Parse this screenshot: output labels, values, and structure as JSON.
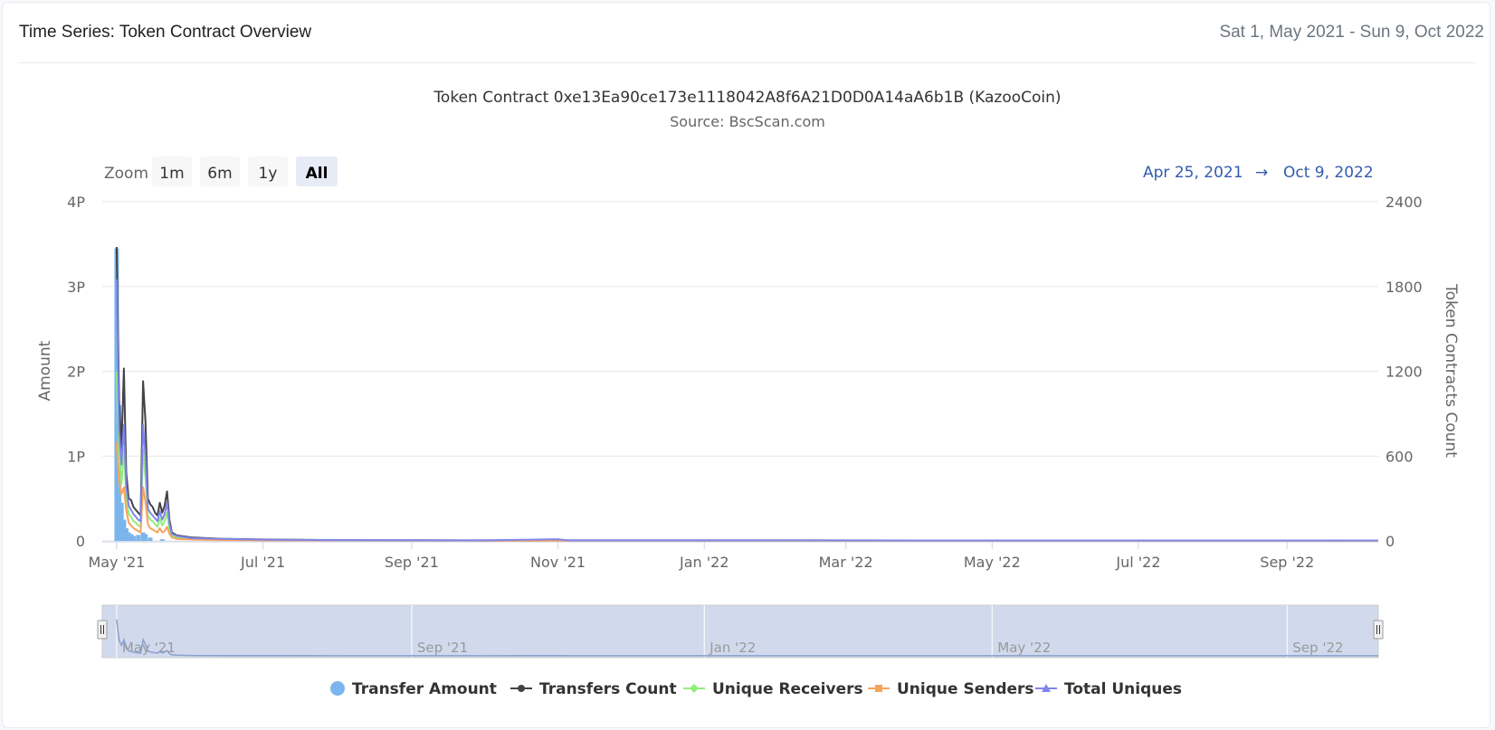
{
  "header": {
    "title": "Time Series: Token Contract Overview",
    "date_range": "Sat 1, May 2021 - Sun 9, Oct 2022"
  },
  "chart": {
    "title": "Token Contract 0xe13Ea90ce173e1118042A8f6A21D0D0A14aA6b1B (KazooCoin)",
    "subtitle": "Source: BscScan.com",
    "zoom_label": "Zoom",
    "zoom_buttons": [
      "1m",
      "6m",
      "1y",
      "All"
    ],
    "zoom_selected": "All",
    "range_from": "Apr 25, 2021",
    "range_arrow": "→",
    "range_to": "Oct 9, 2022"
  },
  "chart_data": {
    "type": "line",
    "x_type": "date",
    "x_range": [
      "2021-04-25",
      "2022-10-09"
    ],
    "xticks": [
      {
        "date": "2021-05-01",
        "label": "May '21"
      },
      {
        "date": "2021-07-01",
        "label": "Jul '21"
      },
      {
        "date": "2021-09-01",
        "label": "Sep '21"
      },
      {
        "date": "2021-11-01",
        "label": "Nov '21"
      },
      {
        "date": "2022-01-01",
        "label": "Jan '22"
      },
      {
        "date": "2022-03-01",
        "label": "Mar '22"
      },
      {
        "date": "2022-05-01",
        "label": "May '22"
      },
      {
        "date": "2022-07-01",
        "label": "Jul '22"
      },
      {
        "date": "2022-09-01",
        "label": "Sep '22"
      }
    ],
    "navigator_ticks": [
      {
        "date": "2021-05-01",
        "label": "May '21"
      },
      {
        "date": "2021-09-01",
        "label": "Sep '21"
      },
      {
        "date": "2022-01-01",
        "label": "Jan '22"
      },
      {
        "date": "2022-05-01",
        "label": "May '22"
      },
      {
        "date": "2022-09-01",
        "label": "Sep '22"
      }
    ],
    "y_left": {
      "label": "Amount",
      "range": [
        0,
        4
      ],
      "ticks": [
        {
          "v": 0,
          "label": "0"
        },
        {
          "v": 1,
          "label": "1P"
        },
        {
          "v": 2,
          "label": "2P"
        },
        {
          "v": 3,
          "label": "3P"
        },
        {
          "v": 4,
          "label": "4P"
        }
      ]
    },
    "y_right": {
      "label": "Token Contracts Count",
      "range": [
        0,
        2400
      ],
      "ticks": [
        {
          "v": 0,
          "label": "0"
        },
        {
          "v": 600,
          "label": "600"
        },
        {
          "v": 1200,
          "label": "1200"
        },
        {
          "v": 1800,
          "label": "1800"
        },
        {
          "v": 2400,
          "label": "2400"
        }
      ]
    },
    "grid": true,
    "legend_position": "bottom",
    "series": [
      {
        "name": "Transfer Amount",
        "kind": "column",
        "axis": "left",
        "color": "#7cb5ec",
        "marker": "circle",
        "points": [
          [
            "2021-05-01",
            3.45
          ],
          [
            "2021-05-02",
            1.6
          ],
          [
            "2021-05-03",
            0.45
          ],
          [
            "2021-05-04",
            0.25
          ],
          [
            "2021-05-05",
            0.15
          ],
          [
            "2021-05-06",
            0.1
          ],
          [
            "2021-05-07",
            0.08
          ],
          [
            "2021-05-08",
            0.06
          ],
          [
            "2021-05-10",
            0.07
          ],
          [
            "2021-05-12",
            0.1
          ],
          [
            "2021-05-13",
            0.08
          ],
          [
            "2021-05-15",
            0.04
          ],
          [
            "2021-05-20",
            0.02
          ]
        ]
      },
      {
        "name": "Transfers Count",
        "kind": "line",
        "axis": "right",
        "color": "#434348",
        "marker": "circle",
        "points": [
          [
            "2021-05-01",
            2080
          ],
          [
            "2021-05-02",
            1000
          ],
          [
            "2021-05-03",
            650
          ],
          [
            "2021-05-04",
            1220
          ],
          [
            "2021-05-05",
            480
          ],
          [
            "2021-05-06",
            300
          ],
          [
            "2021-05-07",
            290
          ],
          [
            "2021-05-08",
            240
          ],
          [
            "2021-05-09",
            220
          ],
          [
            "2021-05-10",
            200
          ],
          [
            "2021-05-11",
            180
          ],
          [
            "2021-05-12",
            1130
          ],
          [
            "2021-05-13",
            850
          ],
          [
            "2021-05-14",
            300
          ],
          [
            "2021-05-15",
            260
          ],
          [
            "2021-05-16",
            240
          ],
          [
            "2021-05-17",
            200
          ],
          [
            "2021-05-18",
            180
          ],
          [
            "2021-05-19",
            270
          ],
          [
            "2021-05-20",
            200
          ],
          [
            "2021-05-21",
            250
          ],
          [
            "2021-05-22",
            350
          ],
          [
            "2021-05-23",
            150
          ],
          [
            "2021-05-24",
            60
          ],
          [
            "2021-05-26",
            40
          ],
          [
            "2021-06-01",
            25
          ],
          [
            "2021-06-15",
            15
          ],
          [
            "2021-07-01",
            10
          ],
          [
            "2021-08-01",
            6
          ],
          [
            "2021-10-01",
            4
          ],
          [
            "2022-10-09",
            3
          ]
        ]
      },
      {
        "name": "Unique Receivers",
        "kind": "line",
        "axis": "right",
        "color": "#90ed7d",
        "marker": "diamond",
        "points": [
          [
            "2021-05-01",
            1200
          ],
          [
            "2021-05-02",
            600
          ],
          [
            "2021-05-03",
            400
          ],
          [
            "2021-05-04",
            650
          ],
          [
            "2021-05-05",
            300
          ],
          [
            "2021-05-06",
            190
          ],
          [
            "2021-05-07",
            170
          ],
          [
            "2021-05-08",
            140
          ],
          [
            "2021-05-09",
            130
          ],
          [
            "2021-05-10",
            110
          ],
          [
            "2021-05-11",
            100
          ],
          [
            "2021-05-12",
            650
          ],
          [
            "2021-05-13",
            450
          ],
          [
            "2021-05-14",
            180
          ],
          [
            "2021-05-15",
            150
          ],
          [
            "2021-05-16",
            140
          ],
          [
            "2021-05-17",
            120
          ],
          [
            "2021-05-18",
            100
          ],
          [
            "2021-05-19",
            160
          ],
          [
            "2021-05-20",
            110
          ],
          [
            "2021-05-21",
            140
          ],
          [
            "2021-05-22",
            200
          ],
          [
            "2021-05-23",
            90
          ],
          [
            "2021-05-24",
            35
          ],
          [
            "2021-05-26",
            25
          ],
          [
            "2021-06-01",
            15
          ],
          [
            "2021-06-15",
            10
          ],
          [
            "2021-07-01",
            6
          ],
          [
            "2021-08-01",
            4
          ],
          [
            "2021-10-01",
            3
          ],
          [
            "2022-10-09",
            2
          ]
        ]
      },
      {
        "name": "Unique Senders",
        "kind": "line",
        "axis": "right",
        "color": "#f7a35c",
        "marker": "square",
        "points": [
          [
            "2021-05-01",
            700
          ],
          [
            "2021-05-02",
            420
          ],
          [
            "2021-05-03",
            330
          ],
          [
            "2021-05-04",
            380
          ],
          [
            "2021-05-05",
            220
          ],
          [
            "2021-05-06",
            130
          ],
          [
            "2021-05-07",
            110
          ],
          [
            "2021-05-08",
            90
          ],
          [
            "2021-05-09",
            80
          ],
          [
            "2021-05-10",
            70
          ],
          [
            "2021-05-11",
            60
          ],
          [
            "2021-05-12",
            380
          ],
          [
            "2021-05-13",
            280
          ],
          [
            "2021-05-14",
            120
          ],
          [
            "2021-05-15",
            90
          ],
          [
            "2021-05-16",
            80
          ],
          [
            "2021-05-17",
            70
          ],
          [
            "2021-05-18",
            60
          ],
          [
            "2021-05-19",
            90
          ],
          [
            "2021-05-20",
            60
          ],
          [
            "2021-05-21",
            70
          ],
          [
            "2021-05-22",
            100
          ],
          [
            "2021-05-23",
            50
          ],
          [
            "2021-05-24",
            25
          ],
          [
            "2021-05-26",
            15
          ],
          [
            "2021-06-01",
            10
          ],
          [
            "2021-06-15",
            6
          ],
          [
            "2021-07-01",
            4
          ],
          [
            "2021-08-01",
            3
          ],
          [
            "2021-10-01",
            2
          ],
          [
            "2022-10-09",
            2
          ]
        ]
      },
      {
        "name": "Total Uniques",
        "kind": "line",
        "axis": "right",
        "color": "#8085e9",
        "marker": "triangle",
        "points": [
          [
            "2021-05-01",
            1850
          ],
          [
            "2021-05-02",
            780
          ],
          [
            "2021-05-03",
            540
          ],
          [
            "2021-05-04",
            820
          ],
          [
            "2021-05-05",
            380
          ],
          [
            "2021-05-06",
            250
          ],
          [
            "2021-05-07",
            220
          ],
          [
            "2021-05-08",
            190
          ],
          [
            "2021-05-09",
            170
          ],
          [
            "2021-05-10",
            150
          ],
          [
            "2021-05-11",
            140
          ],
          [
            "2021-05-12",
            820
          ],
          [
            "2021-05-13",
            600
          ],
          [
            "2021-05-14",
            230
          ],
          [
            "2021-05-15",
            200
          ],
          [
            "2021-05-16",
            180
          ],
          [
            "2021-05-17",
            160
          ],
          [
            "2021-05-18",
            140
          ],
          [
            "2021-05-19",
            210
          ],
          [
            "2021-05-20",
            150
          ],
          [
            "2021-05-21",
            190
          ],
          [
            "2021-05-22",
            270
          ],
          [
            "2021-05-23",
            120
          ],
          [
            "2021-05-24",
            50
          ],
          [
            "2021-05-26",
            35
          ],
          [
            "2021-06-01",
            20
          ],
          [
            "2021-06-15",
            14
          ],
          [
            "2021-07-01",
            9
          ],
          [
            "2021-08-01",
            6
          ],
          [
            "2021-10-01",
            4
          ],
          [
            "2021-11-01",
            12
          ],
          [
            "2021-11-05",
            4
          ],
          [
            "2022-10-09",
            3
          ]
        ]
      }
    ]
  }
}
